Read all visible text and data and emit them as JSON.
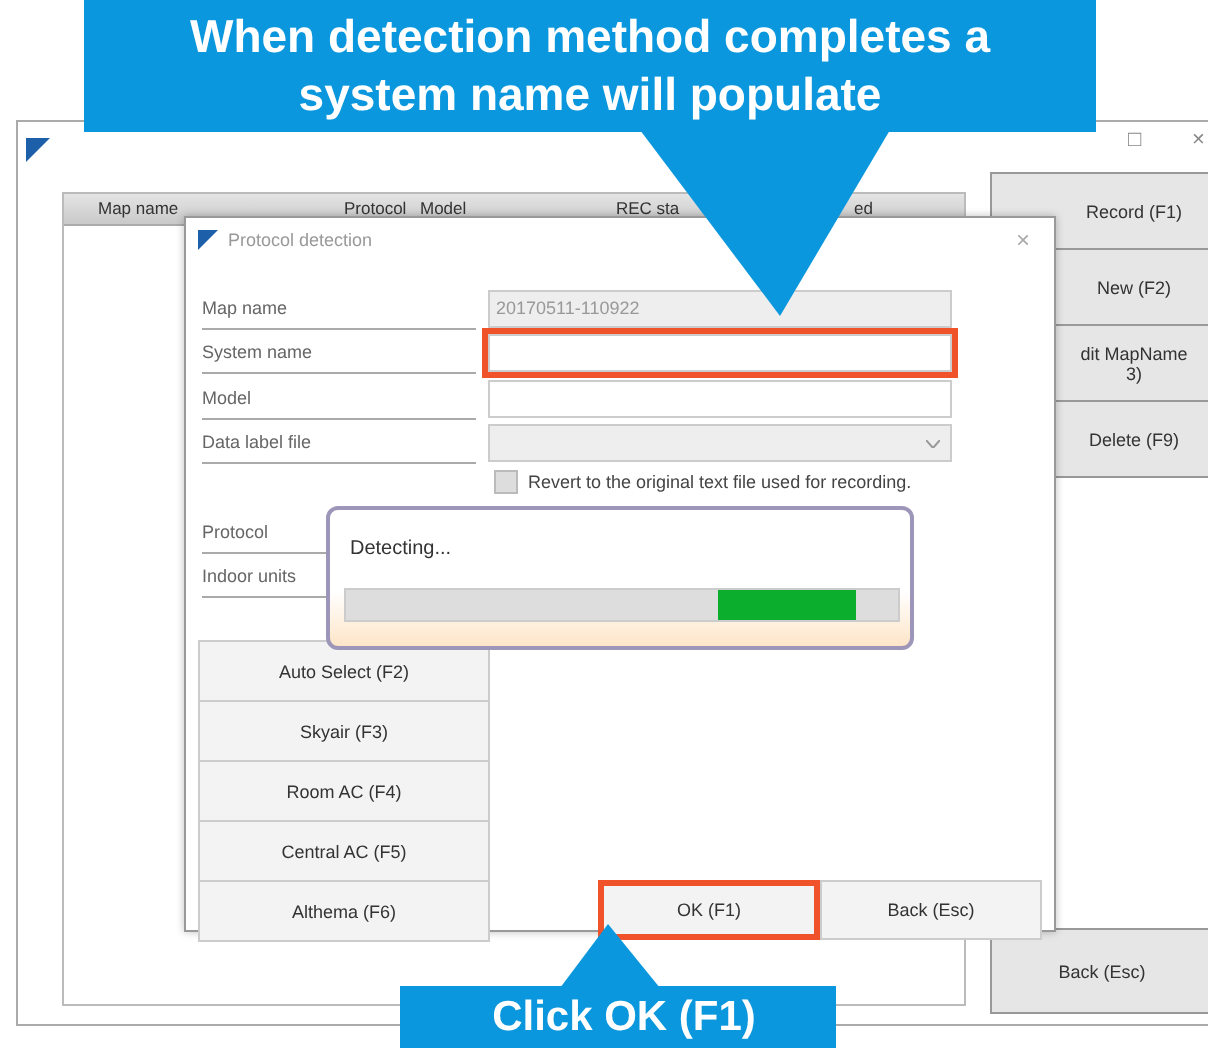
{
  "window": {
    "controls": [
      "□",
      "×"
    ]
  },
  "table": {
    "columns": [
      "Map name",
      "Protocol",
      "Model",
      "REC sta",
      "ed"
    ]
  },
  "side_buttons": [
    {
      "lines": [
        "Record (F1)"
      ]
    },
    {
      "lines": [
        "New (F2)"
      ]
    },
    {
      "lines": [
        "dit MapName",
        "3)"
      ]
    },
    {
      "lines": [
        "Delete (F9)"
      ]
    }
  ],
  "back_button": "Back (Esc)",
  "dialog": {
    "title": "Protocol detection",
    "close": "×",
    "fields": [
      {
        "label": "Map name",
        "kind": "text",
        "value": "20170511-110922",
        "disabled": true,
        "highlighted": false
      },
      {
        "label": "System name",
        "kind": "text",
        "disabled": false,
        "highlighted": true
      },
      {
        "label": "Model",
        "kind": "text",
        "disabled": false,
        "highlighted": false
      },
      {
        "label": "Data label file",
        "kind": "combo",
        "disabled": true,
        "highlighted": false
      }
    ],
    "checkbox": {
      "label": "Revert to the original text file used for recording.",
      "checked": false
    },
    "labels": [
      "Protocol",
      "Indoor units"
    ],
    "type_buttons": [
      "Auto Select (F2)",
      "Skyair (F3)",
      "Room AC (F4)",
      "Central AC (F5)",
      "Althema (F6)"
    ],
    "actions": [
      {
        "label": "OK (F1)",
        "highlighted": true
      },
      {
        "label": "Back (Esc)",
        "highlighted": false
      }
    ]
  },
  "progress": {
    "title": "Detecting..."
  },
  "callouts": [
    {
      "kind": "top",
      "text": "When detection method completes a system name will populate"
    },
    {
      "kind": "bottom",
      "text": "Click OK (F1)"
    }
  ]
}
